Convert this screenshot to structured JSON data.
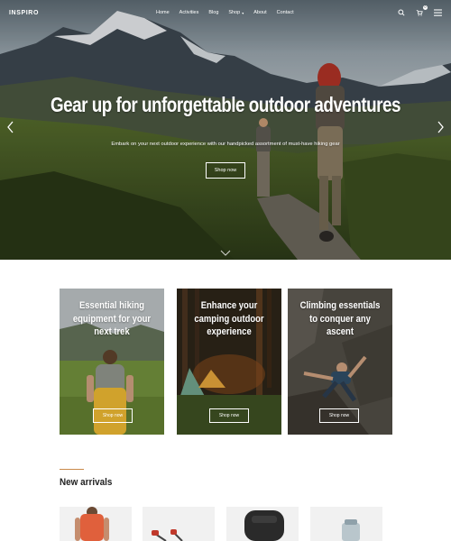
{
  "brand": {
    "logo_text": "INSPIRO"
  },
  "nav": {
    "items": [
      {
        "label": "Home"
      },
      {
        "label": "Activities"
      },
      {
        "label": "Blog"
      },
      {
        "label": "Shop",
        "has_dropdown": true
      },
      {
        "label": "About"
      },
      {
        "label": "Contact"
      }
    ],
    "icons": [
      "search-icon",
      "cart-icon",
      "menu-icon"
    ],
    "cart_count": "0"
  },
  "hero": {
    "title": "Gear up for unforgettable outdoor adventures",
    "subtitle": "Embark on your next outdoor experience with our handpicked assortment of must-have hiking gear",
    "button_label": "Shop now"
  },
  "categories": [
    {
      "title": "Essential hiking equipment for your next trek",
      "button_label": "Shop now"
    },
    {
      "title": "Enhance your camping outdoor experience",
      "button_label": "Shop now"
    },
    {
      "title": "Climbing essentials to conquer any ascent",
      "button_label": "Shop now"
    }
  ],
  "new_arrivals": {
    "title": "New arrivals",
    "accent_color": "#c98a4a"
  }
}
